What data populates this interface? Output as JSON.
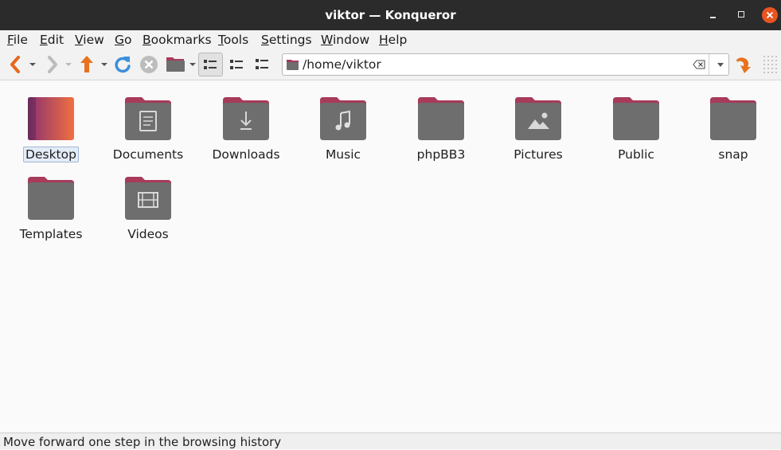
{
  "window": {
    "title": "viktor — Konqueror"
  },
  "menu": [
    {
      "label": "File",
      "accel": "F",
      "rest": "ile"
    },
    {
      "label": "Edit",
      "accel": "E",
      "rest": "dit"
    },
    {
      "label": "View",
      "accel": "V",
      "rest": "iew"
    },
    {
      "label": "Go",
      "accel": "G",
      "rest": "o"
    },
    {
      "label": "Bookmarks",
      "accel": "B",
      "rest": "ookmarks"
    },
    {
      "label": "Tools",
      "accel": "T",
      "rest": "ools"
    },
    {
      "label": "Settings",
      "accel": "S",
      "rest": "ettings"
    },
    {
      "label": "Window",
      "accel": "W",
      "rest": "indow"
    },
    {
      "label": "Help",
      "accel": "H",
      "rest": "elp"
    }
  ],
  "toolbar": {
    "icons": [
      "back-icon",
      "forward-icon",
      "up-icon",
      "reload-icon",
      "stop-icon",
      "folder-icon",
      "icon-view-icon",
      "compact-view-icon",
      "details-view-icon",
      "go-icon"
    ]
  },
  "location": {
    "url": "/home/viktor"
  },
  "files": [
    {
      "name": "Desktop",
      "icon": "desktop-folder-icon",
      "selected": true
    },
    {
      "name": "Documents",
      "icon": "documents-folder-icon"
    },
    {
      "name": "Downloads",
      "icon": "downloads-folder-icon"
    },
    {
      "name": "Music",
      "icon": "music-folder-icon"
    },
    {
      "name": "phpBB3",
      "icon": "folder-icon"
    },
    {
      "name": "Pictures",
      "icon": "pictures-folder-icon"
    },
    {
      "name": "Public",
      "icon": "folder-icon"
    },
    {
      "name": "snap",
      "icon": "folder-icon"
    },
    {
      "name": "Templates",
      "icon": "folder-icon"
    },
    {
      "name": "Videos",
      "icon": "videos-folder-icon"
    }
  ],
  "status": {
    "text": "Move forward one step in the browsing history"
  },
  "colors": {
    "accent": "#e95420",
    "folder_body": "#737373",
    "folder_tab": "#a83a5a",
    "titlebar": "#2b2b2b"
  }
}
